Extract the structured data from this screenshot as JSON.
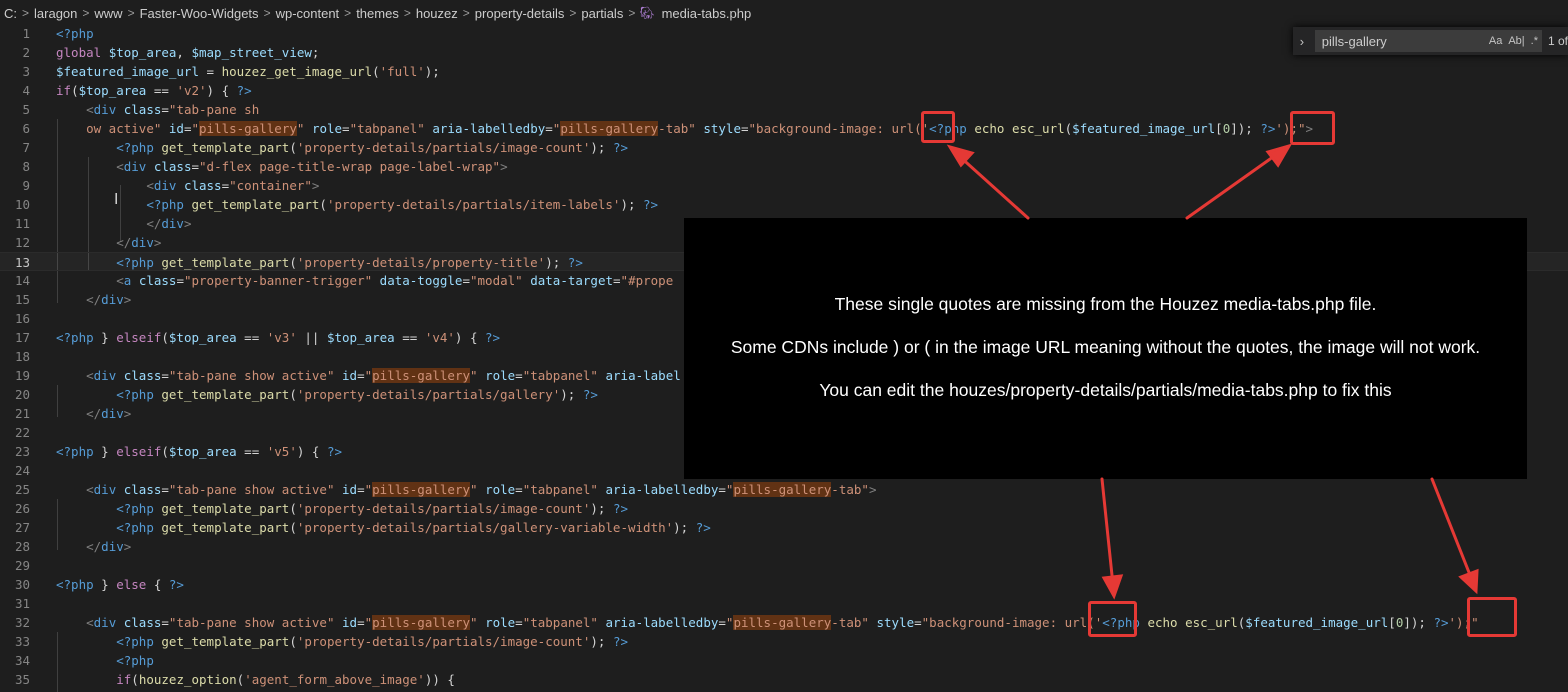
{
  "breadcrumb": {
    "items": [
      "C:",
      "laragon",
      "www",
      "Faster-Woo-Widgets",
      "wp-content",
      "themes",
      "houzez",
      "property-details",
      "partials",
      "media-tabs.php"
    ]
  },
  "find_widget": {
    "query": "pills-gallery",
    "match_case_label": "Aa",
    "whole_word_label": "Ab|",
    "regex_label": ".*",
    "count_text": "1 of"
  },
  "editor": {
    "current_line": 13,
    "line_numbers": [
      "1",
      "2",
      "3",
      "4",
      "5",
      "6",
      "7",
      "8",
      "9",
      "10",
      "11",
      "12",
      "13",
      "14",
      "15",
      "16",
      "17",
      "18",
      "19",
      "20",
      "21",
      "22",
      "23",
      "24",
      "25",
      "26",
      "27",
      "28",
      "29",
      "30",
      "31",
      "32",
      "33",
      "34",
      "35"
    ]
  },
  "callout": {
    "line1": "These single quotes are missing from the Houzez media-tabs.php file.",
    "line2": "Some CDNs include ) or ( in the image URL meaning without the quotes, the image will not work.",
    "line3": "You can edit the houzes/property-details/partials/media-tabs.php to fix this"
  },
  "colors": {
    "background": "#1e1e1e",
    "annotation_red": "#e53935",
    "highlight": "#613214"
  }
}
